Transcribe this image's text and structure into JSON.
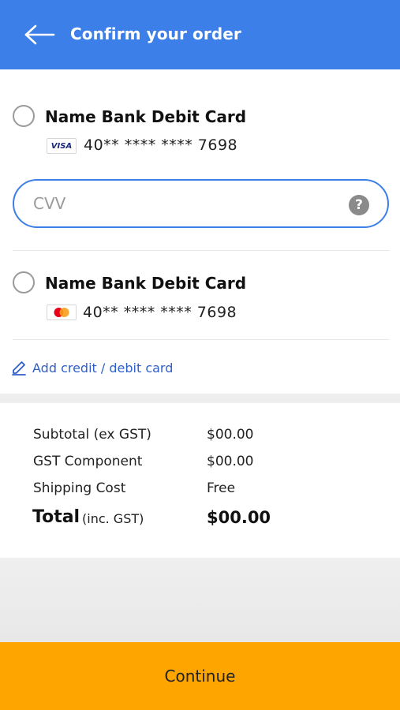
{
  "header": {
    "title": "Confirm your order",
    "back_icon": "arrow-left-icon",
    "color": "#3d7fe8"
  },
  "payment_methods": [
    {
      "name": "Name Bank Debit Card",
      "brand": "VISA",
      "number": "40** **** **** 7698",
      "selected": false
    },
    {
      "name": "Name Bank Debit Card",
      "brand": "mastercard-icon",
      "number": "40** **** **** 7698",
      "selected": false
    }
  ],
  "cvv": {
    "placeholder": "CVV",
    "value": "",
    "help_icon": "?",
    "border_color": "#3d7fe8"
  },
  "add_card": {
    "label": "Add credit / debit card",
    "icon": "pencil-icon"
  },
  "summary": {
    "subtotal_label": "Subtotal (ex GST)",
    "subtotal_value": "$00.00",
    "gst_label": "GST Component",
    "gst_value": "$00.00",
    "shipping_label": "Shipping Cost",
    "shipping_value": "Free",
    "total_label": "Total",
    "total_sub": "(inc. GST)",
    "total_value": "$00.00"
  },
  "footer": {
    "continue_label": "Continue",
    "button_color": "#ffa500"
  }
}
